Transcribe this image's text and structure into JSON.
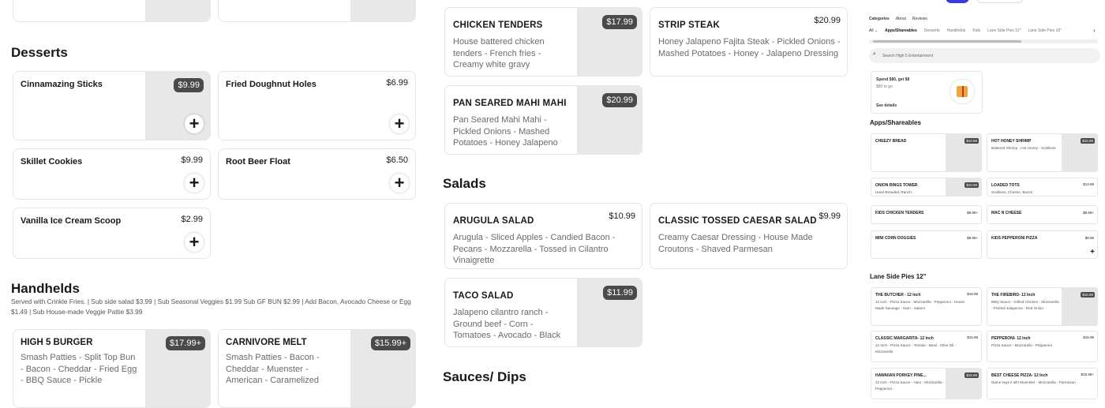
{
  "left": {
    "desserts_title": "Desserts",
    "desserts": [
      {
        "name": "Cinnamazing Sticks",
        "price": "$9.99",
        "has_image": true
      },
      {
        "name": "Fried Doughnut Holes",
        "price": "$6.99",
        "has_image": false
      },
      {
        "name": "Skillet Cookies",
        "price": "$9.99",
        "has_image": false
      },
      {
        "name": "Root Beer Float",
        "price": "$6.50",
        "has_image": false
      },
      {
        "name": "Vanilla Ice Cream Scoop",
        "price": "$2.99",
        "has_image": false
      }
    ],
    "handhelds_title": "Handhelds",
    "handhelds_note": "Served with Crinkle Fries. | Sub side salad $3.99 | Sub Seasonal Veggies $1.99 Sub GF BUN $2.99 | Add Bacon, Avocado Cheese or Egg $1.49 | Sub House-made Veggie Pattie $3.99",
    "handhelds": [
      {
        "name": "HIGH 5 BURGER",
        "price": "$17.99+",
        "desc": "Smash Patties - Split Top Bun - Bacon - Cheddar - Fried Egg - BBQ Sauce - Pickle"
      },
      {
        "name": "CARNIVORE MELT",
        "price": "$15.99+",
        "desc": "Smash Patties - Bacon - Cheddar - Muenster - American - Caramelized"
      }
    ]
  },
  "middle": {
    "items": [
      {
        "name": "CHICKEN TENDERS",
        "price": "$17.99",
        "desc": "House battered chicken tenders - French fries - Creamy white gravy"
      },
      {
        "name": "STRIP STEAK",
        "price": "$20.99",
        "desc": "Honey Jalapeno Fajita Steak - Pickled Onions - Mashed Potatoes - Honey - Jalapeno Dressing"
      },
      {
        "name": "PAN SEARED MAHI MAHI",
        "price": "$20.99",
        "desc": "Pan Seared Mahi Mahi - Pickled Onions - Mashed Potatoes - Honey Jalapeno"
      }
    ],
    "salads_title": "Salads",
    "salads": [
      {
        "name": "ARUGULA SALAD",
        "price": "$10.99",
        "desc": "Arugula - Sliced Apples - Candied Bacon - Pecans - Mozzarella - Tossed in Cilantro Vinaigrette"
      },
      {
        "name": "CLASSIC TOSSED CAESAR SALAD",
        "price": "$9.99",
        "desc": "Creamy Caesar Dressing - House Made Croutons - Shaved Parmesan"
      },
      {
        "name": "TACO SALAD",
        "price": "$11.99",
        "desc": "Jalapeno cilantro ranch - Ground beef - Corn - Tomatoes - Avocado - Black"
      }
    ],
    "sauces_title": "Sauces/ Dips"
  },
  "right": {
    "top_links": [
      "Categories",
      "About",
      "Reviews"
    ],
    "categories": [
      "All",
      "Apps/Shareables",
      "Desserts",
      "Handhelds",
      "Kids",
      "Lane Side Pies 12\"",
      "Lane Side Pies 18\""
    ],
    "search_placeholder": "Search High 5 Entertainment",
    "promo": {
      "title": "Spend $80, get $8",
      "sub": "$80 to go",
      "link": "See details"
    },
    "apps_title": "Apps/Shareables",
    "apps": [
      {
        "name": "CHEEZY BREAD",
        "price": "$10.99",
        "desc": ""
      },
      {
        "name": "HOT HONEY SHRIMP",
        "price": "$15.99",
        "desc": "Battered Shrimp - Hot Honey - Scallions"
      },
      {
        "name": "ONION RINGS TOWER",
        "price": "$10.99",
        "desc": "Hand-Breaded, Ranch-"
      },
      {
        "name": "LOADED TOTS",
        "price": "$13.99",
        "desc": "Scallions, Cheese, Bacon"
      },
      {
        "name": "KIDS CHICKEN TENDERS",
        "price": "$8.99+",
        "desc": ""
      },
      {
        "name": "MAC N CHEESE",
        "price": "$8.99+",
        "desc": ""
      },
      {
        "name": "MINI CORN DOGGIES",
        "price": "$8.99+",
        "desc": ""
      },
      {
        "name": "KIDS PEPPERONI PIZZA",
        "price": "$8.99",
        "desc": ""
      }
    ],
    "pies_title": "Lane Side Pies 12\"",
    "pies": [
      {
        "name": "THE BUTCHER - 12 Inch",
        "price": "$18.99",
        "desc": "12 inch - Pizza Sauce - Mozzarella - Pepperoni - House Made Sausage - Ham - Salami"
      },
      {
        "name": "THE FIREBIRD- 12 Inch",
        "price": "$16.99",
        "desc": "BBQ Sauce - Grilled Chicken - Mozzarella - Pickled Jalapenos - Red Onion"
      },
      {
        "name": "CLASSIC MARGARITA- 12 Inch",
        "price": "$15.99",
        "desc": "12 Inch - Pizza Sauce - Tomato - Basil - Olive Oil - Mozzarella"
      },
      {
        "name": "PEPPERONI- 12 Inch",
        "price": "$16.99",
        "desc": "Pizza Sauce - Mozzarella - Pepperoni"
      },
      {
        "name": "HAWAIIAN PORKEY PINE...",
        "price": "$16.99",
        "desc": "12 inch - Pizza Sauce - Ham - Mozzarella - Pepperoni -"
      },
      {
        "name": "BEST CHEESE PIZZA- 12 Inch",
        "price": "$15.99+",
        "desc": "Name says it all!! Muenster - Mozzarella - Parmesan"
      }
    ]
  }
}
